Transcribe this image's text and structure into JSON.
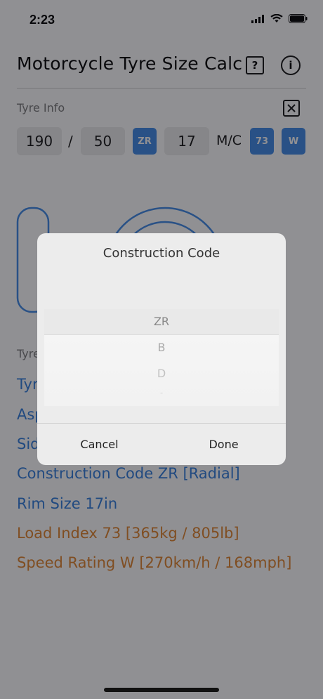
{
  "status": {
    "time": "2:23"
  },
  "header": {
    "title": "Motorcycle Tyre Size Calc",
    "help_icon": "?",
    "info_icon": "i"
  },
  "tyre_info": {
    "label": "Tyre Info",
    "width": "190",
    "sep": "/",
    "aspect": "50",
    "construction": "ZR",
    "rim": "17",
    "mc": "M/C",
    "load_index": "73",
    "speed_rating": "W"
  },
  "results": {
    "title": "Tyre",
    "line1": "Tyr",
    "line2": "Asp",
    "line3": "Sid",
    "construction": "Construction Code ZR [Radial]",
    "rim": "Rim Size 17in",
    "load": "Load Index 73 [365kg / 805lb]",
    "speed": "Speed Rating W [270km/h / 168mph]"
  },
  "dialog": {
    "title": "Construction Code",
    "options": [
      "ZR",
      "B",
      "D",
      "-"
    ],
    "cancel": "Cancel",
    "done": "Done"
  },
  "colors": {
    "accent": "#3e89e6",
    "blue_text": "#2f7bdc",
    "orange_text": "#e0832a"
  }
}
